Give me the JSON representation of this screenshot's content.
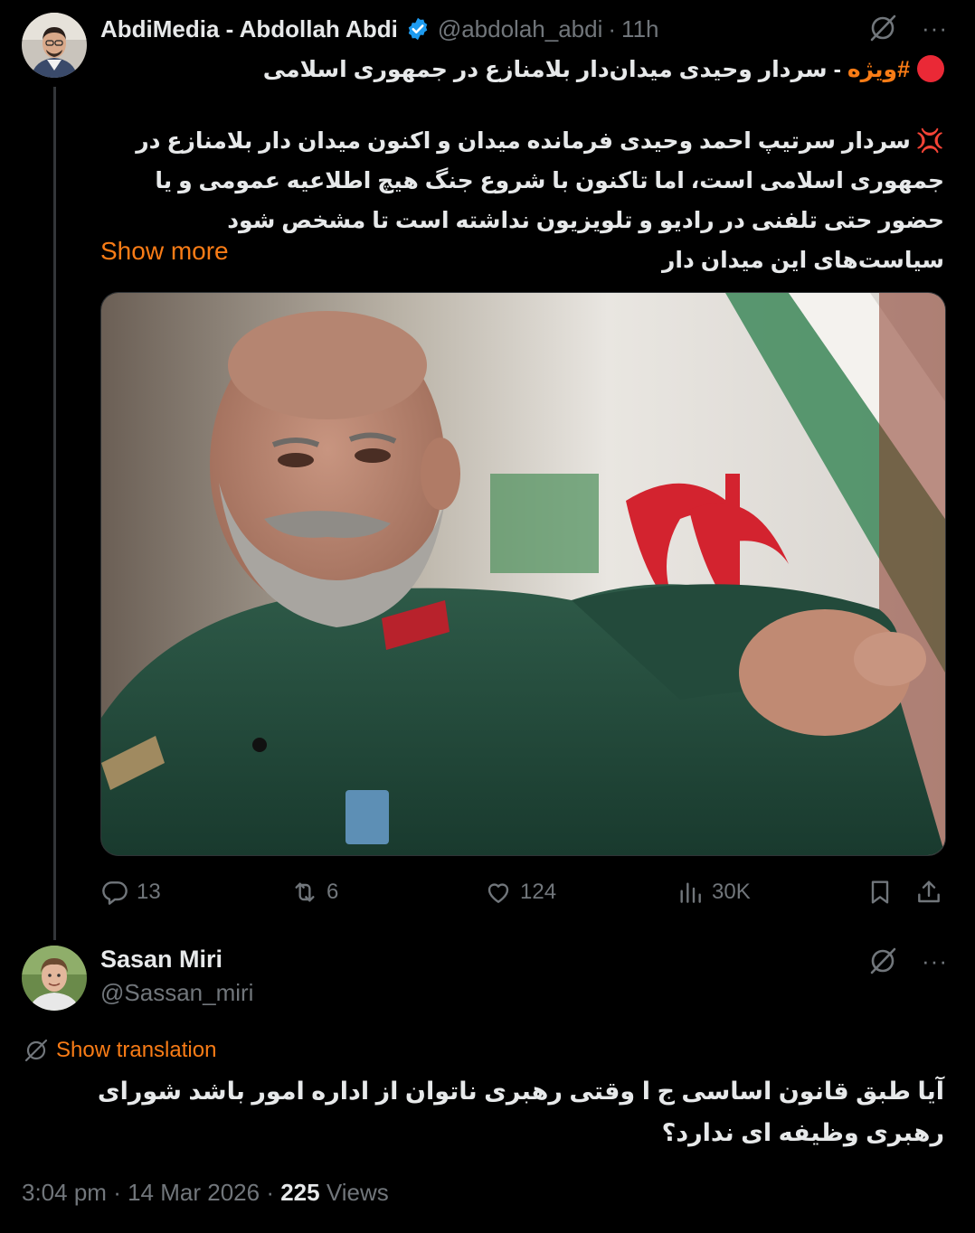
{
  "tweet": {
    "author_name": "AbdiMedia - Abdollah Abdi",
    "handle": "@abdolah_abdi",
    "separator": "·",
    "time": "11h",
    "more_label": "···",
    "hashtag": "#ویژه",
    "headline": " - سردار وحیدی میدان‌دار بلامنازع در جمهوری اسلامی",
    "anger_emoji": "💢",
    "body": "سردار سرتیپ احمد وحیدی فرمانده میدان و اکنون میدان دار بلامنازع در جمهوری اسلامی است، اما تاکنون با شروع جنگ هیچ اطلاعیه عمومی و یا حضور حتی تلفنی در رادیو و تلویزیون نداشته است تا مشخص شود سیاست‌های این میدان دار",
    "show_more": "Show more",
    "stats": {
      "replies": "13",
      "retweets": "6",
      "likes": "124",
      "views": "30K"
    }
  },
  "reply": {
    "author_name": "Sasan Miri",
    "handle": "@Sassan_miri",
    "more_label": "···",
    "show_translation": "Show translation",
    "text": "آیا طبق قانون اساسی ج ا وقتی رهبری ناتوان از اداره امور باشد شورای رهبری وظیفه ای ندارد؟",
    "time": "3:04 pm",
    "separator": "·",
    "date": "14 Mar 2026",
    "views_count": "225",
    "views_label": " Views"
  },
  "colors": {
    "background": "#000000",
    "text": "#e7e9ea",
    "muted": "#71767b",
    "accent": "#f97c16",
    "verified": "#1d9bf0",
    "divider": "#333639"
  },
  "icons": [
    "grok-icon",
    "more-icon",
    "verified-badge-icon",
    "reply-icon",
    "retweet-icon",
    "like-icon",
    "views-icon",
    "bookmark-icon",
    "share-icon",
    "translate-icon"
  ]
}
